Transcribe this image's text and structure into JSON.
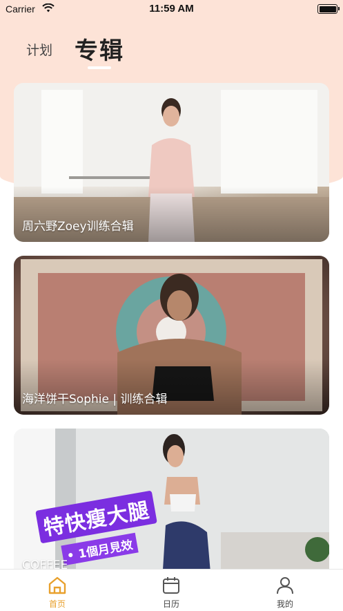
{
  "status_bar": {
    "carrier": "Carrier",
    "time": "11:59 AM"
  },
  "tabs": {
    "plan": "计划",
    "album": "专辑"
  },
  "cards": [
    {
      "title": "周六野Zoey训练合辑"
    },
    {
      "title": "海洋饼干Sophie | 训练合辑"
    },
    {
      "title": "COFFEE",
      "promo": "特快瘦大腿",
      "promo_sub": "• 1個月見效"
    }
  ],
  "tabbar": [
    {
      "label": "首页",
      "icon": "home-icon",
      "active": true
    },
    {
      "label": "日历",
      "icon": "calendar-icon",
      "active": false
    },
    {
      "label": "我的",
      "icon": "person-icon",
      "active": false
    }
  ],
  "colors": {
    "accent": "#e8a02c",
    "header_bg": "#fde3d7",
    "promo": "#7b2ee0"
  }
}
